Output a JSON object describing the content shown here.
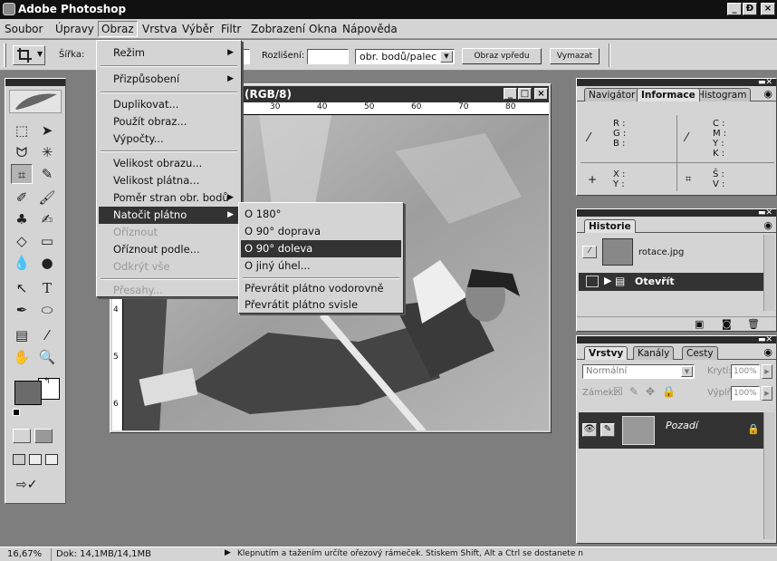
{
  "app": {
    "title": "Adobe Photoshop"
  },
  "window_buttons": {
    "min": "_",
    "max": "Ɖ",
    "close": "×"
  },
  "menubar": [
    "Soubor",
    "Úpravy",
    "Obraz",
    "Vrstva",
    "Výběr",
    "Filtr",
    "Zobrazení",
    "Okna",
    "Nápověda"
  ],
  "options_bar": {
    "width_label": "Šířka:",
    "resolution_label": "Rozlišení:",
    "unit_select": "obr. bodů/palec",
    "front_image_button": "Obraz vpředu",
    "clear_button": "Vymazat"
  },
  "document": {
    "title": "(RGB/8)",
    "ruler_top": [
      "30",
      "40",
      "50",
      "60",
      "70",
      "80"
    ],
    "ruler_left": [
      "4",
      "5",
      "6"
    ]
  },
  "image_menu": {
    "items": [
      {
        "label": "Režim",
        "submenu": true
      },
      {
        "label": "Přizpůsobení",
        "submenu": true
      },
      {
        "label": "Duplikovat..."
      },
      {
        "label": "Použít obraz..."
      },
      {
        "label": "Výpočty..."
      },
      {
        "label": "Velikost obrazu..."
      },
      {
        "label": "Velikost plátna..."
      },
      {
        "label": "Poměr stran obr. bodů",
        "submenu": true
      },
      {
        "label": "Natočit plátno",
        "submenu": true,
        "highlighted": true
      },
      {
        "label": "Oříznout",
        "disabled": true
      },
      {
        "label": "Oříznout podle..."
      },
      {
        "label": "Odkrýt vše",
        "disabled": true
      },
      {
        "label": "Přesahy...",
        "disabled": true
      }
    ]
  },
  "rotate_submenu": {
    "items": [
      {
        "label": "O 180°"
      },
      {
        "label": "O 90° doprava"
      },
      {
        "label": "O 90° doleva",
        "highlighted": true
      },
      {
        "label": "O jiný úhel..."
      },
      {
        "label": "Převrátit plátno vodorovně"
      },
      {
        "label": "Převrátit plátno svisle"
      }
    ]
  },
  "navigator_palette": {
    "tabs": [
      "Navigátor",
      "Informace",
      "Histogram"
    ],
    "rgb": [
      "R :",
      "G :",
      "B :"
    ],
    "cmyk": [
      "C :",
      "M :",
      "Y :",
      "K :"
    ],
    "xy": [
      "X :",
      "Y :"
    ],
    "wh": [
      "Š :",
      "V :"
    ]
  },
  "history_palette": {
    "tab": "Historie",
    "snapshot": "rotace.jpg",
    "step": "Otevřít"
  },
  "layers_palette": {
    "tabs": [
      "Vrstvy",
      "Kanály",
      "Cesty"
    ],
    "blend_mode": "Normální",
    "opacity_label": "Krytí:",
    "opacity_value": "100%",
    "lock_label": "Zámek:",
    "fill_label": "Výplň:",
    "fill_value": "100%",
    "layer_name": "Pozadí"
  },
  "statusbar": {
    "zoom": "16,67%",
    "doc_size": "Dok: 14,1MB/14,1MB",
    "hint": "Klepnutím a tažením určíte ořezový rámeček. Stiskem Shift, Alt a Ctrl se dostanete n"
  }
}
